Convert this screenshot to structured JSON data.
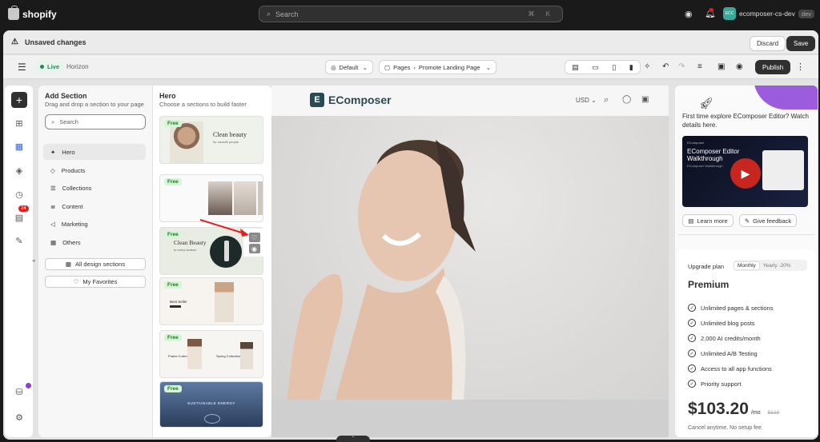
{
  "topbar": {
    "logo_text": "shopify",
    "search_placeholder": "Search",
    "search_shortcut": "⌘ K",
    "store_avatar": "ECC",
    "store_name": "ecomposer-cs-dev",
    "store_tag": "dev",
    "notification_count": ""
  },
  "header": {
    "unsaved_text": "Unsaved changes",
    "discard_label": "Discard",
    "save_label": "Save"
  },
  "toolbar": {
    "live_label": "Live",
    "theme_name": "Horizon",
    "template_select": "Default",
    "pages_label": "Pages",
    "page_name": "Promote Landing Page",
    "publish_label": "Publish"
  },
  "rail": {
    "badge_count": "24"
  },
  "add_section": {
    "title": "Add Section",
    "subtitle": "Drag and drop a section to your page",
    "search_placeholder": "Search",
    "categories": [
      {
        "label": "Hero",
        "icon": "star-icon"
      },
      {
        "label": "Products",
        "icon": "tag-icon"
      },
      {
        "label": "Collections",
        "icon": "list-icon"
      },
      {
        "label": "Content",
        "icon": "text-icon"
      },
      {
        "label": "Marketing",
        "icon": "megaphone-icon"
      },
      {
        "label": "Others",
        "icon": "grid-icon"
      }
    ],
    "all_sections_label": "All design sections",
    "favorites_label": "My Favorites"
  },
  "hero_panel": {
    "title": "Hero",
    "subtitle": "Choose a sections to build faster",
    "cards": [
      {
        "badge": "Free",
        "text": "Clean beauty",
        "sub": "for smooth people"
      },
      {
        "badge": "Free",
        "text": "",
        "sub": ""
      },
      {
        "badge": "Free",
        "text": "Clean Beauty",
        "sub": "to every season"
      },
      {
        "badge": "Free",
        "text": "Best Seller",
        "sub": ""
      },
      {
        "badge": "Free",
        "text": "Prairie Collection",
        "sub": "Spring Collection"
      },
      {
        "badge": "Free",
        "text": "SUSTAINABLE ENERGY",
        "sub": ""
      }
    ]
  },
  "canvas": {
    "brand": "EComposer",
    "currency": "USD"
  },
  "right_panel": {
    "explore_text": "First time explore EComposer Editor? Watch details here.",
    "video_title": "EComposer Editor Walkthrough",
    "video_sub": "EComposer Walkthrough",
    "learn_more": "Learn more",
    "give_feedback": "Give feedback",
    "upgrade_label": "Upgrade plan",
    "monthly": "Monthly",
    "yearly": "Yearly -20%",
    "plan_name": "Premium",
    "features": [
      "Unlimited pages & sections",
      "Unlimited blog posts",
      "2,000 AI credits/month",
      "Unlimited A/B Testing",
      "Access to all app functions",
      "Priority support"
    ],
    "price": "$103.20",
    "per": "/mo",
    "old_price": "$129",
    "cancel_text": "Cancel anytime. No setup fee."
  },
  "colors": {
    "accent_live": "#29845a",
    "highlight": "#ffffff",
    "arrow": "#e51c1c",
    "badge_red": "#e51c1c"
  }
}
